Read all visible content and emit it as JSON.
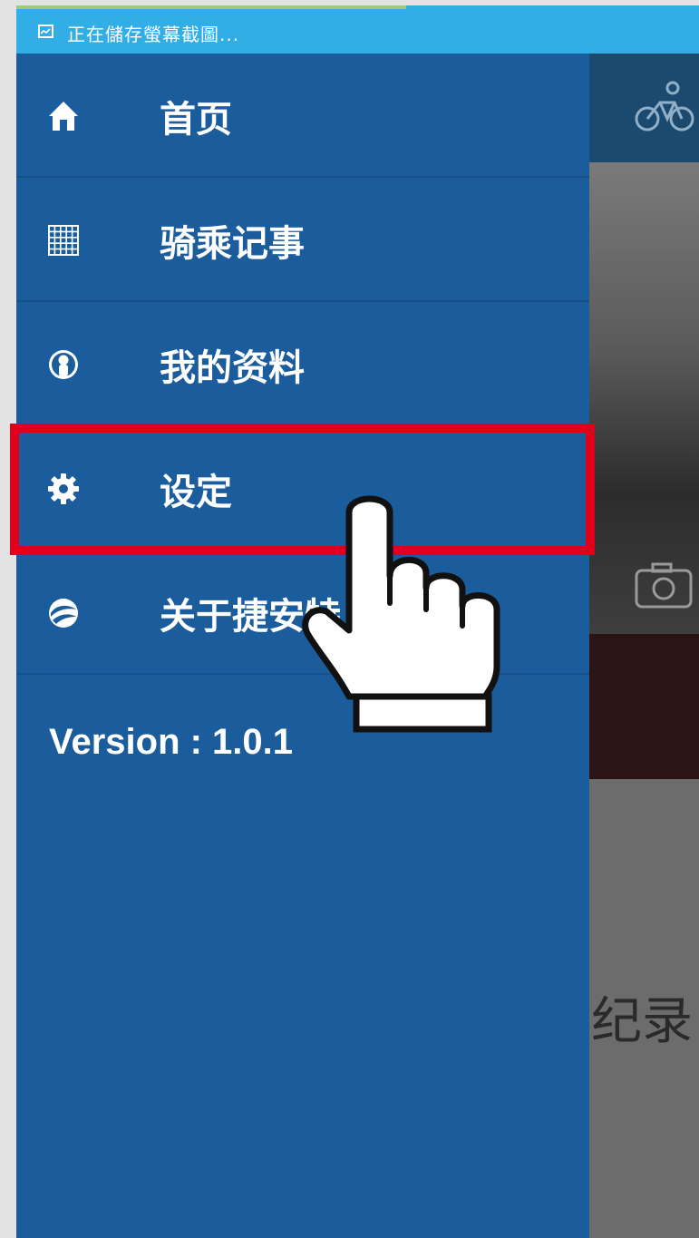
{
  "status_bar": {
    "text": "正在儲存螢幕截圖...",
    "icon": "screenshot-icon",
    "background": "#32aee6",
    "progress_accent": "#9ad070"
  },
  "drawer": {
    "background": "#1b5d9c",
    "items": [
      {
        "label": "首页",
        "icon": "home-icon"
      },
      {
        "label": "骑乘记事",
        "icon": "grid-icon"
      },
      {
        "label": "我的资料",
        "icon": "profile-icon"
      },
      {
        "label": "设定",
        "icon": "gear-icon",
        "highlighted": true
      },
      {
        "label": "关于捷安特",
        "icon": "giant-logo-icon"
      }
    ],
    "version": "Version : 1.0.1"
  },
  "background_app": {
    "record_text": "纪录",
    "icons": [
      "bike-icon",
      "camera-icon"
    ]
  },
  "overlay": {
    "highlight_color": "#e0001a",
    "pointer": "hand-pointer-icon"
  }
}
